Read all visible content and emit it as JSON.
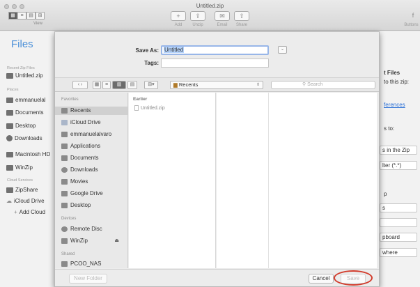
{
  "window": {
    "title": "Untitled.zip",
    "view_caption": "View",
    "view_modes": [
      "▦",
      "≡",
      "▤",
      "⊞"
    ],
    "toolbar": [
      {
        "label": "Add",
        "icon": "plus-icon",
        "glyph": "+"
      },
      {
        "label": "Unzip",
        "icon": "unzip-icon",
        "glyph": "⇪"
      },
      {
        "label": "Email",
        "icon": "mail-icon",
        "glyph": "✉"
      },
      {
        "label": "Share",
        "icon": "share-icon",
        "glyph": "⇧"
      }
    ],
    "right_toolbar": {
      "label": "Buttons",
      "glyph": "f"
    }
  },
  "files_sidebar": {
    "title": "Files",
    "recent_header": "Recent Zip Files",
    "recent": [
      "Untitled.zip"
    ],
    "places_header": "Places",
    "places": [
      "emmanuelal",
      "Documents",
      "Desktop",
      "Downloads",
      "Macintosh HD",
      "WinZip"
    ],
    "cloud_header": "Cloud Services",
    "cloud": [
      "ZipShare",
      "iCloud Drive",
      "Add Cloud"
    ]
  },
  "right_panel": {
    "heading": "t Files",
    "line1": "to this zip:",
    "link": "ferences",
    "line2": "s to:",
    "box1": "s in the Zip",
    "box2": "lter (*.*)",
    "line3": "p",
    "box3": "s",
    "box4": "",
    "box5": "pboard",
    "box6": "where"
  },
  "save_dialog": {
    "save_as_label": "Save As:",
    "save_as_value": "Untitled",
    "tags_label": "Tags:",
    "location": "Recents",
    "search_placeholder": "Search",
    "favorites_header": "Favorites",
    "favorites": [
      {
        "label": "Recents",
        "icon": "clock-icon",
        "selected": true
      },
      {
        "label": "iCloud Drive",
        "icon": "cloud-icon",
        "selected": false
      },
      {
        "label": "emmanuelalvaro",
        "icon": "home-icon",
        "selected": false
      },
      {
        "label": "Applications",
        "icon": "apps-icon",
        "selected": false
      },
      {
        "label": "Documents",
        "icon": "document-icon",
        "selected": false
      },
      {
        "label": "Downloads",
        "icon": "download-icon",
        "selected": false
      },
      {
        "label": "Movies",
        "icon": "film-icon",
        "selected": false
      },
      {
        "label": "Google Drive",
        "icon": "folder-icon",
        "selected": false
      },
      {
        "label": "Desktop",
        "icon": "desktop-icon",
        "selected": false
      }
    ],
    "devices_header": "Devices",
    "devices": [
      "Remote Disc",
      "WinZip"
    ],
    "shared_header": "Shared",
    "shared": [
      "PCOO_NAS"
    ],
    "column_header": "Earlier",
    "files": [
      "Untitled.zip"
    ],
    "new_folder": "New Folder",
    "cancel": "Cancel",
    "save": "Save"
  }
}
